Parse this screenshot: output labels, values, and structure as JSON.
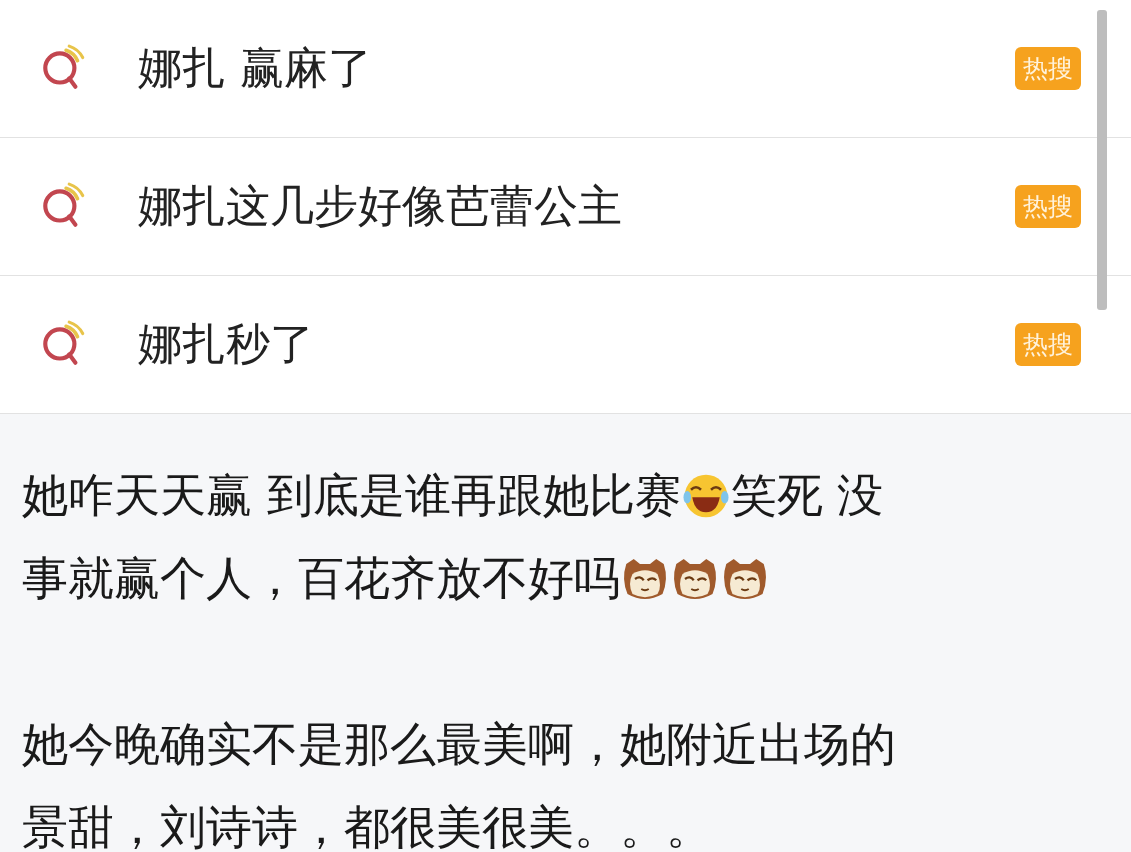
{
  "hot_searches": [
    {
      "query": "娜扎 赢麻了",
      "badge": "热搜"
    },
    {
      "query": "娜扎这几步好像芭蕾公主",
      "badge": "热搜"
    },
    {
      "query": "娜扎秒了",
      "badge": "热搜"
    }
  ],
  "comment": {
    "paragraphs": [
      {
        "lines": [
          [
            {
              "kind": "text",
              "text": "她咋天天赢 到底是谁再跟她比赛"
            },
            {
              "kind": "laugh"
            },
            {
              "kind": "text",
              "text": "笑死 没"
            }
          ],
          [
            {
              "kind": "text",
              "text": "事就赢个人，百花齐放不好吗"
            },
            {
              "kind": "cat"
            },
            {
              "kind": "cat"
            },
            {
              "kind": "cat"
            }
          ]
        ]
      },
      {
        "lines": [
          [
            {
              "kind": "text",
              "text": "她今晚确实不是那么最美啊，她附近出场的"
            }
          ],
          [
            {
              "kind": "text",
              "text": "景甜，刘诗诗，都很美很美。。。"
            }
          ]
        ]
      }
    ]
  }
}
